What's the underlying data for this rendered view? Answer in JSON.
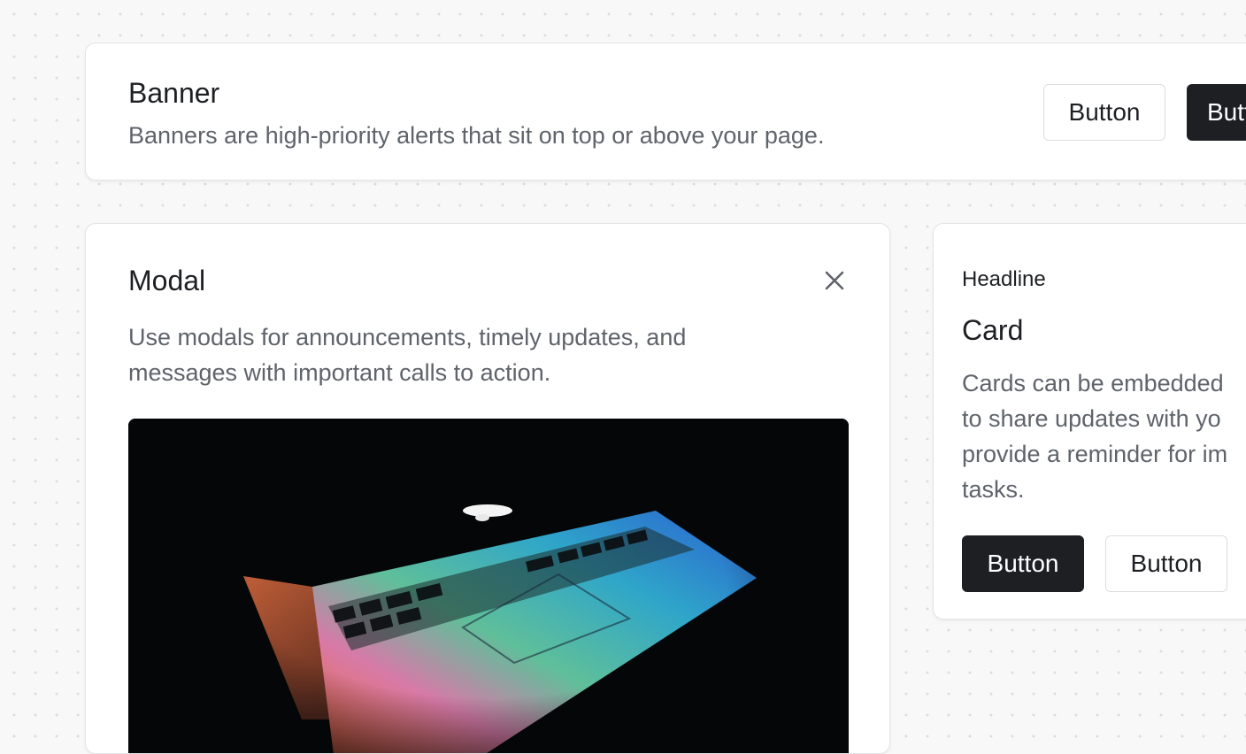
{
  "banner": {
    "title": "Banner",
    "description": "Banners are high-priority alerts that sit on top or above your page.",
    "secondary_button_label": "Button",
    "primary_button_label": "Button"
  },
  "modal": {
    "title": "Modal",
    "close_icon": "close-icon",
    "description": "Use modals for announcements, timely updates, and messages with important calls to action.",
    "image_subject": "laptop-keyboard-with-rainbow-light"
  },
  "card": {
    "headline": "Headline",
    "title": "Card",
    "description_lines": [
      "Cards can be embedded",
      "to share updates with yo",
      "provide a reminder for im",
      "tasks."
    ],
    "primary_button_label": "Button",
    "secondary_button_label": "Button"
  },
  "colors": {
    "background": "#f8f8f8",
    "surface": "#ffffff",
    "text_primary": "#1d1f23",
    "text_secondary": "#5f636a",
    "button_primary": "#1d1f23",
    "border": "#e3e4e6"
  }
}
